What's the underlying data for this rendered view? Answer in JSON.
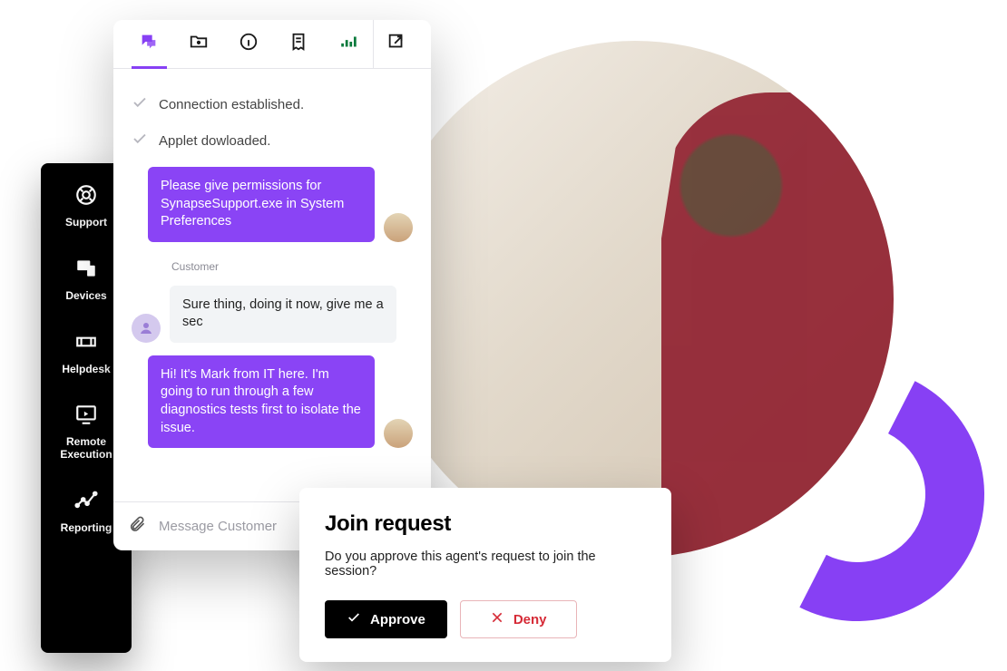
{
  "sidebar": {
    "items": [
      {
        "label": "Support"
      },
      {
        "label": "Devices"
      },
      {
        "label": "Helpdesk"
      },
      {
        "label": "Remote\nExecution"
      },
      {
        "label": "Reporting"
      }
    ]
  },
  "chat": {
    "status": [
      "Connection established.",
      "Applet dowloaded."
    ],
    "messages": [
      {
        "role": "agent",
        "text": "Please give permissions for SynapseSupport.exe in System Preferences"
      },
      {
        "role": "customer",
        "label": "Customer",
        "text": "Sure thing, doing it now, give me a sec"
      },
      {
        "role": "agent",
        "text": "Hi! It's Mark from IT here. I'm going to run through a few diagnostics tests first to isolate the issue."
      }
    ],
    "input_placeholder": "Message Customer"
  },
  "join": {
    "title": "Join request",
    "body": "Do you approve this agent's request to join the session?",
    "approve": "Approve",
    "deny": "Deny"
  },
  "colors": {
    "accent": "#8740f4",
    "danger": "#d62a36"
  }
}
